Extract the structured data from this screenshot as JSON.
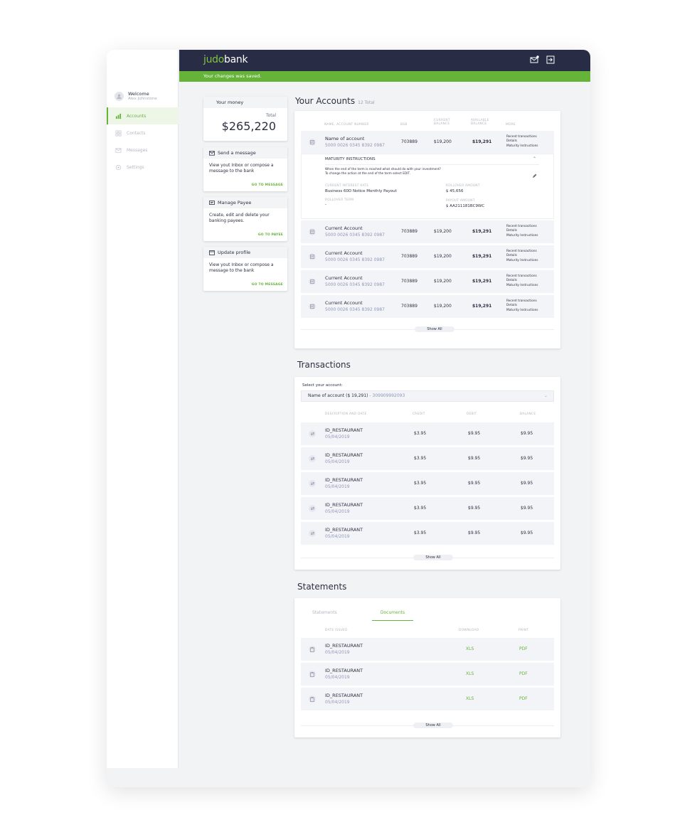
{
  "app": {
    "logo_part1": "judo",
    "logo_part2": "bank",
    "banner": "Your changes was saved."
  },
  "user": {
    "greeting": "Welcome",
    "name": "Alex Johnstone"
  },
  "nav": [
    {
      "label": "Accounts",
      "icon": "accounts-icon",
      "active": true
    },
    {
      "label": "Contacts",
      "icon": "contacts-icon",
      "active": false
    },
    {
      "label": "Messages",
      "icon": "messages-icon",
      "active": false
    },
    {
      "label": "Settings",
      "icon": "settings-icon",
      "active": false
    }
  ],
  "money": {
    "title": "Your money",
    "total_label": "Total",
    "total": "$265,220"
  },
  "quick_cards": [
    {
      "title": "Send a message",
      "icon": "mail-icon",
      "text": "View yout Inbox or compose a message to the bank",
      "link": "GO TO MESSAGE"
    },
    {
      "title": "Manage Payee",
      "icon": "payee-icon",
      "text": "Create, edit and delete your banking payees.",
      "link": "GO TO PAYEE"
    },
    {
      "title": "Update profile",
      "icon": "profile-icon",
      "text": "View yout Inbox or compose a message to the bank",
      "link": "GO TO MESSAGE"
    }
  ],
  "accounts": {
    "title": "Your Accounts",
    "total": "12 Total",
    "headers": {
      "name": "NAME, ACCOUNT NUMBER",
      "bsb": "BSB",
      "current1": "CURRENT",
      "current2": "BALANCE",
      "available1": "AVAILABLE",
      "available2": "BALANCE",
      "more": "MORE"
    },
    "more_links": [
      "Recent transactions",
      "Details",
      "Maturity Instructions"
    ],
    "rows": [
      {
        "name": "Name of account",
        "number": "5000 0026 0345 8392 0987",
        "bsb": "703889",
        "current": "$19,200",
        "available": "$19,291"
      },
      {
        "name": "Current Account",
        "number": "5000 0026 0345 8392 0987",
        "bsb": "703889",
        "current": "$19,200",
        "available": "$19,291"
      },
      {
        "name": "Current Account",
        "number": "5000 0026 0345 8392 0987",
        "bsb": "703889",
        "current": "$19,200",
        "available": "$19,291"
      },
      {
        "name": "Current Account",
        "number": "5000 0026 0345 8392 0987",
        "bsb": "703889",
        "current": "$19,200",
        "available": "$19,291"
      },
      {
        "name": "Current Account",
        "number": "5000 0026 0345 8392 0987",
        "bsb": "703889",
        "current": "$19,200",
        "available": "$19,291"
      }
    ],
    "maturity": {
      "title": "MATURITY INSTRUCTIONS",
      "desc1": "When the end of the term is reached what should do with your investment?",
      "desc2": "To change the action at the end of the term select EDIT.",
      "rate_label": "CURRENT INTEREST RATE",
      "rate_value": "Business 60D Notice Monthly Payout",
      "term_label": "ROLLOVER TERM",
      "term_value": "-",
      "amount_label": "ROLLOVER AMOUNT",
      "amount_value": "$ 45,656",
      "payout_label": "PAYOUT AMOUNT",
      "payout_value": "$ AA211181BC9WC"
    },
    "show_all": "Show All"
  },
  "transactions": {
    "title": "Transactions",
    "select_label": "Select your account:",
    "select_value": "Name of account ($ 19,291)",
    "select_number": " - 309909992093",
    "headers": {
      "desc": "DESCRIPTION AND DATE",
      "credit": "CREDIT",
      "debit": "DEBIT",
      "balance": "BALANCE"
    },
    "rows": [
      {
        "name": "ID_RESTAURANT",
        "date": "05/04/2019",
        "credit": "$3.95",
        "debit": "$9.95",
        "balance": "$9.95"
      },
      {
        "name": "ID_RESTAURANT",
        "date": "05/04/2019",
        "credit": "$3.95",
        "debit": "$9.95",
        "balance": "$9.95"
      },
      {
        "name": "ID_RESTAURANT",
        "date": "05/04/2019",
        "credit": "$3.95",
        "debit": "$9.95",
        "balance": "$9.95"
      },
      {
        "name": "ID_RESTAURANT",
        "date": "05/04/2019",
        "credit": "$3.95",
        "debit": "$9.95",
        "balance": "$9.95"
      },
      {
        "name": "ID_RESTAURANT",
        "date": "05/04/2019",
        "credit": "$3.95",
        "debit": "$9.95",
        "balance": "$9.95"
      }
    ],
    "show_all": "Show All"
  },
  "statements": {
    "title": "Statements",
    "tabs": [
      "Statements",
      "Documents"
    ],
    "active_tab": 1,
    "headers": {
      "date": "DATE ISSUED",
      "download": "DOWNLOAD",
      "print": "PRINT"
    },
    "rows": [
      {
        "name": "ID_RESTAURANT",
        "date": "05/04/2019",
        "download": "XLS",
        "print": "PDF"
      },
      {
        "name": "ID_RESTAURANT",
        "date": "05/04/2019",
        "download": "XLS",
        "print": "PDF"
      },
      {
        "name": "ID_RESTAURANT",
        "date": "05/04/2019",
        "download": "XLS",
        "print": "PDF"
      }
    ],
    "show_all": "Show All"
  },
  "colors": {
    "brand_green": "#66b33a",
    "navy": "#282d45",
    "account_number": "#8e96b8"
  }
}
